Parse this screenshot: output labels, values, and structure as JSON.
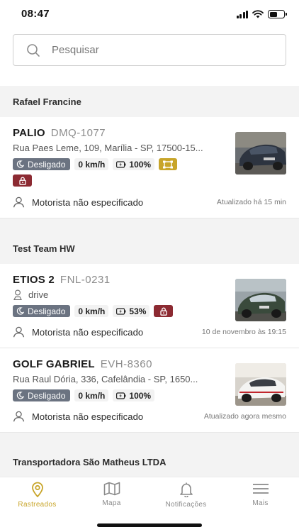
{
  "status_bar": {
    "time": "08:47"
  },
  "search": {
    "placeholder": "Pesquisar"
  },
  "colors": {
    "accent": "#c8a52a",
    "lock": "#8c2a32",
    "status_off": "#6b7381"
  },
  "groups": [
    {
      "name": "Rafael Francine",
      "vehicles": [
        {
          "name": "PALIO",
          "plate": "DMQ-1077",
          "address": "Rua Paes Leme, 109, Marília - SP, 17500-15...",
          "status": "Desligado",
          "speed": "0 km/h",
          "battery": "100%",
          "driver": "Motorista não especificado",
          "updated": "Atualizado há 15 min"
        }
      ]
    },
    {
      "name": "Test Team HW",
      "vehicles": [
        {
          "name": "ETIOS 2",
          "plate": "FNL-0231",
          "location_label": "drive",
          "status": "Desligado",
          "speed": "0 km/h",
          "battery": "53%",
          "driver": "Motorista não especificado",
          "updated": "10 de novembro às 19:15"
        },
        {
          "name": "GOLF GABRIEL",
          "plate": "EVH-8360",
          "address": "Rua Raul Dória, 336, Cafelândia - SP, 1650...",
          "status": "Desligado",
          "speed": "0 km/h",
          "battery": "100%",
          "driver": "Motorista não especificado",
          "updated": "Atualizado agora mesmo"
        }
      ]
    },
    {
      "name": "Transportadora São Matheus LTDA",
      "vehicles": []
    }
  ],
  "tabs": [
    {
      "label": "Rastreados",
      "icon": "location-pin-icon",
      "active": true
    },
    {
      "label": "Mapa",
      "icon": "map-icon",
      "active": false
    },
    {
      "label": "Notificações",
      "icon": "bell-icon",
      "active": false
    },
    {
      "label": "Mais",
      "icon": "menu-icon",
      "active": false
    }
  ]
}
